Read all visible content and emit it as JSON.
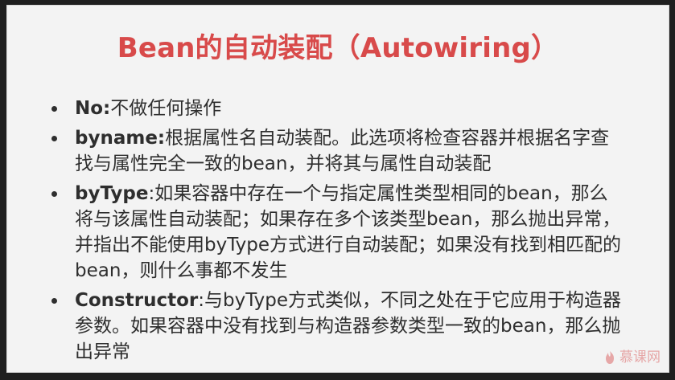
{
  "slide": {
    "title": "Bean的自动装配（Autowiring）",
    "bullets": [
      {
        "term": "No:",
        "text": "不做任何操作"
      },
      {
        "term": "byname:",
        "text": "根据属性名自动装配。此选项将检查容器并根据名字查找与属性完全一致的bean，并将其与属性自动装配"
      },
      {
        "term": "byType",
        "text": ":如果容器中存在一个与指定属性类型相同的bean，那么将与该属性自动装配；如果存在多个该类型bean，那么抛出异常，并指出不能使用byType方式进行自动装配；如果没有找到相匹配的bean，则什么事都不发生"
      },
      {
        "term": "Constructor",
        "text": ":与byType方式类似，不同之处在于它应用于构造器参数。如果容器中没有找到与构造器参数类型一致的bean，那么抛出异常"
      }
    ],
    "watermark": "慕课网",
    "colors": {
      "title": "#d84a4a",
      "text": "#2e2e2e",
      "background": "#f3f3f3",
      "watermark": "#e6a7a7"
    }
  }
}
